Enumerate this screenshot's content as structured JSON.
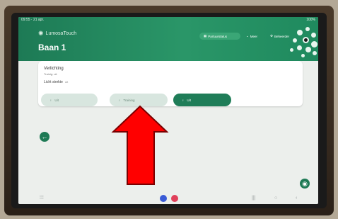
{
  "status_bar": {
    "time": "09:55 · 21 apr.",
    "battery": "100%"
  },
  "header": {
    "logo_text": "LumosaTouch",
    "title": "Baan 1",
    "buttons": {
      "parts": "Partuurstatus",
      "meer": "Meer",
      "beheerder": "Beheerder"
    }
  },
  "card": {
    "heading": "Verlichting",
    "subheading": "Trainig: uit",
    "light_label": "Licht sterkte",
    "light_value": "uit",
    "options": {
      "uit": "Uit",
      "training": "Training",
      "aan": "Uit"
    }
  },
  "colors": {
    "brand_green": "#1f7d58",
    "annotation_arrow": "#ff0000"
  },
  "icons": {
    "back": "arrow-left-icon",
    "bulb": "bulb-icon",
    "help": "info-icon"
  }
}
